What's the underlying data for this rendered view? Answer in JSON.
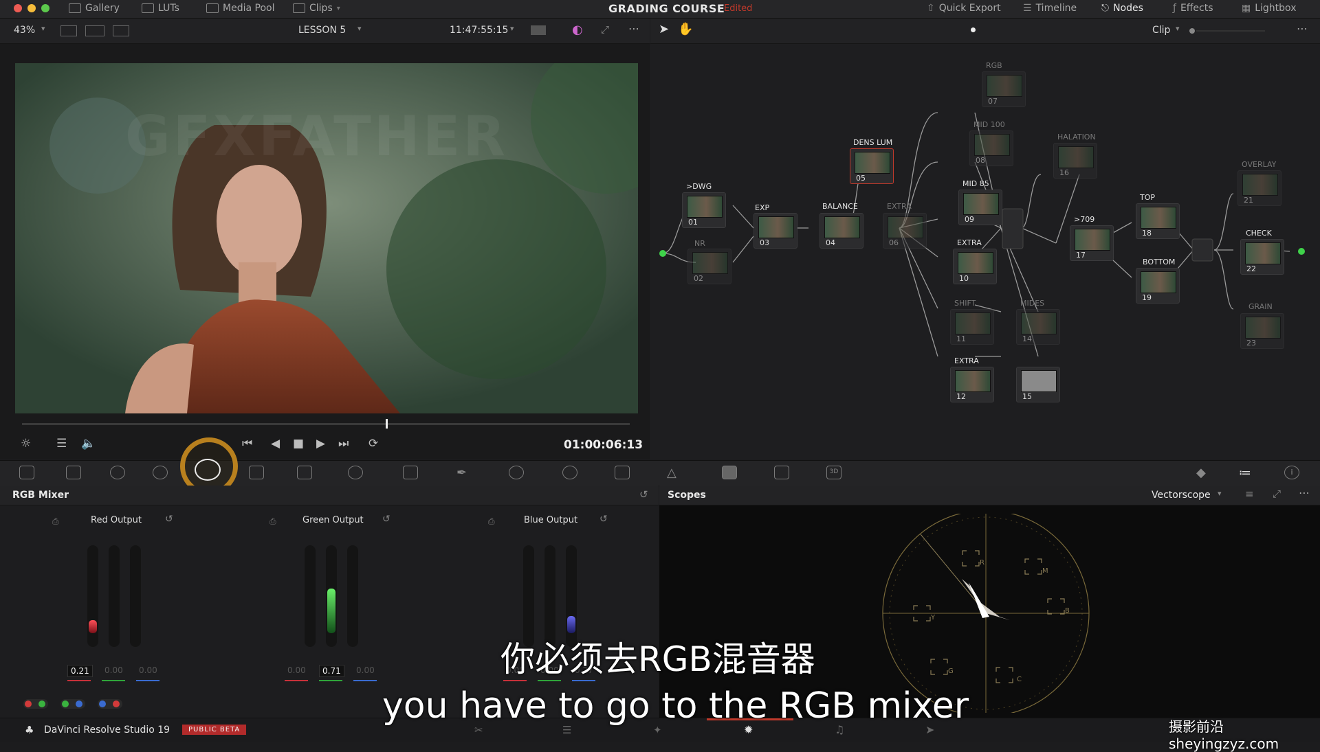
{
  "topbar": {
    "tabs": [
      {
        "label": "Gallery",
        "icon": "gallery-icon"
      },
      {
        "label": "LUTs",
        "icon": "luts-icon"
      },
      {
        "label": "Media Pool",
        "icon": "media-pool-icon"
      },
      {
        "label": "Clips",
        "icon": "clips-icon"
      }
    ],
    "project_title": "GRADING COURSE",
    "project_status": "Edited",
    "right_tabs": [
      {
        "label": "Quick Export",
        "icon": "export-icon"
      },
      {
        "label": "Timeline",
        "icon": "timeline-icon"
      },
      {
        "label": "Nodes",
        "icon": "nodes-icon"
      },
      {
        "label": "Effects",
        "icon": "effects-icon"
      },
      {
        "label": "Lightbox",
        "icon": "lightbox-icon"
      }
    ]
  },
  "viewer": {
    "zoom": "43%",
    "timeline_name": "LESSON 5",
    "source_timecode": "11:47:55:15",
    "playhead_timecode": "01:00:06:13",
    "overlay_watermark": "GFXFATHER",
    "playhead_fraction": 0.6
  },
  "node_editor": {
    "mode": "Clip",
    "nodes": [
      {
        "id": "01",
        "label": ">DWG"
      },
      {
        "id": "02",
        "label": "NR",
        "disabled": true
      },
      {
        "id": "03",
        "label": "EXP"
      },
      {
        "id": "04",
        "label": "BALANCE"
      },
      {
        "id": "05",
        "label": "DENS LUM",
        "selected": true
      },
      {
        "id": "06",
        "label": "EXTRA",
        "disabled": true
      },
      {
        "id": "07",
        "label": "RGB",
        "disabled": true
      },
      {
        "id": "08",
        "label": "MID 100",
        "disabled": true
      },
      {
        "id": "09",
        "label": "MID 85"
      },
      {
        "id": "10",
        "label": "EXTRA"
      },
      {
        "id": "11",
        "label": "SHIFT",
        "disabled": true
      },
      {
        "id": "12",
        "label": "EXTRA"
      },
      {
        "id": "14",
        "label": "MIDES",
        "disabled": true
      },
      {
        "id": "15",
        "label": ""
      },
      {
        "id": "16",
        "label": "HALATION",
        "disabled": true
      },
      {
        "id": "17",
        "label": ">709"
      },
      {
        "id": "18",
        "label": "TOP"
      },
      {
        "id": "19",
        "label": "BOTTOM"
      },
      {
        "id": "21",
        "label": "OVERLAY",
        "disabled": true
      },
      {
        "id": "22",
        "label": "CHECK"
      },
      {
        "id": "23",
        "label": "GRAIN",
        "disabled": true
      }
    ]
  },
  "rgb_mixer": {
    "title": "RGB Mixer",
    "outputs": [
      {
        "label": "Red Output",
        "values": [
          "0.21",
          "0.00",
          "0.00"
        ],
        "level": 0.21,
        "color": "#d8303a"
      },
      {
        "label": "Green Output",
        "values": [
          "0.00",
          "0.71",
          "0.00"
        ],
        "level": 0.71,
        "color": "#35c23d"
      },
      {
        "label": "Blue Output",
        "values": [
          "0.00",
          "0.00",
          "0.27"
        ],
        "level": 0.27,
        "color": "#3f3fc8"
      }
    ]
  },
  "scopes": {
    "title": "Scopes",
    "type": "Vectorscope",
    "targets": [
      "R",
      "M",
      "B",
      "C",
      "G",
      "Y"
    ]
  },
  "statusbar": {
    "app_name": "DaVinci Resolve Studio 19",
    "badge": "PUBLIC BETA"
  },
  "subtitles": {
    "chinese": "你必须去RGB混音器",
    "english": "you have to go to the RGB mixer"
  },
  "watermark_site": "摄影前沿 sheyingzyz.com"
}
